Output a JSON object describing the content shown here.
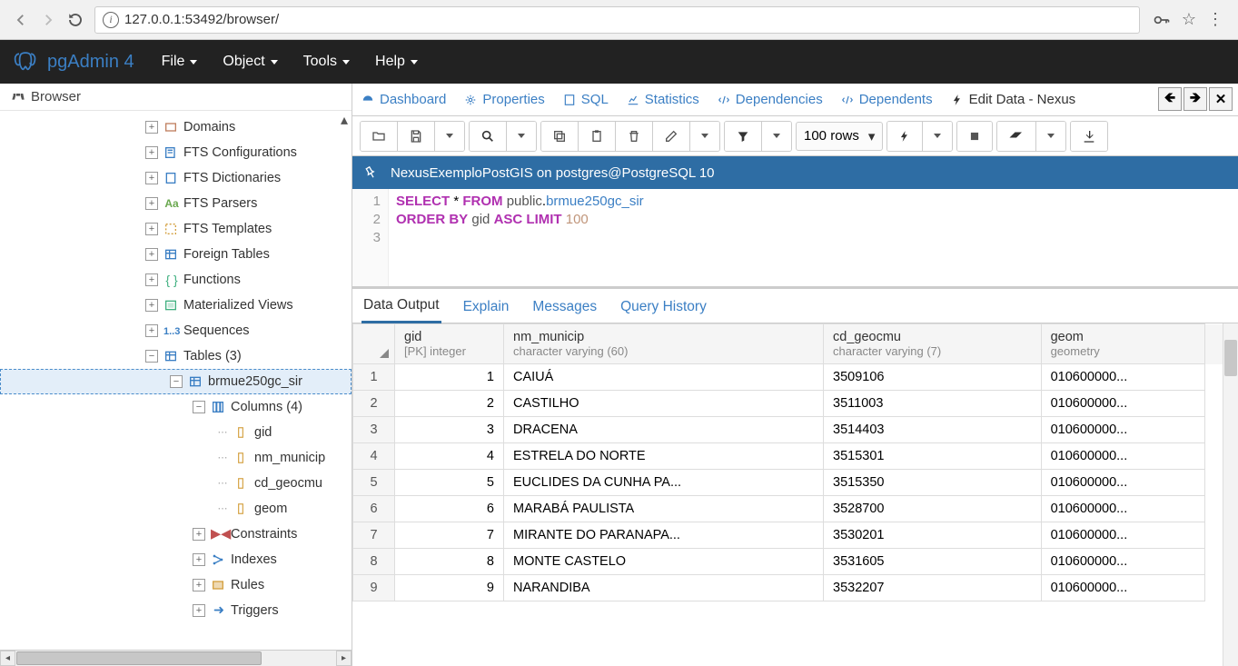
{
  "chrome": {
    "url": "127.0.0.1:53492/browser/"
  },
  "app": {
    "brand": "pgAdmin 4",
    "menu": [
      "File",
      "Object",
      "Tools",
      "Help"
    ]
  },
  "browser_panel": {
    "title": "Browser"
  },
  "tree": [
    {
      "depth": 0,
      "toggle": "+",
      "icon": "domain",
      "label": "Domains",
      "color": "#c08060"
    },
    {
      "depth": 0,
      "toggle": "+",
      "icon": "fts-conf",
      "label": "FTS Configurations",
      "color": "#3b7fc4"
    },
    {
      "depth": 0,
      "toggle": "+",
      "icon": "fts-dict",
      "label": "FTS Dictionaries",
      "color": "#3b7fc4"
    },
    {
      "depth": 0,
      "toggle": "+",
      "icon": "aa",
      "label": "FTS Parsers",
      "color": "#6aa84f"
    },
    {
      "depth": 0,
      "toggle": "+",
      "icon": "fts-tmpl",
      "label": "FTS Templates",
      "color": "#d4a040"
    },
    {
      "depth": 0,
      "toggle": "+",
      "icon": "table",
      "label": "Foreign Tables",
      "color": "#3b7fc4"
    },
    {
      "depth": 0,
      "toggle": "+",
      "icon": "func",
      "label": "Functions",
      "color": "#40b080"
    },
    {
      "depth": 0,
      "toggle": "+",
      "icon": "mview",
      "label": "Materialized Views",
      "color": "#40b080"
    },
    {
      "depth": 0,
      "toggle": "+",
      "icon": "seq",
      "label": "Sequences",
      "color": "#3b7fc4"
    },
    {
      "depth": 0,
      "toggle": "-",
      "icon": "table",
      "label": "Tables (3)",
      "color": "#3b7fc4"
    },
    {
      "depth": 1,
      "toggle": "-",
      "icon": "table",
      "label": "brmue250gc_sir",
      "color": "#3b7fc4",
      "selected": true
    },
    {
      "depth": 2,
      "toggle": "-",
      "icon": "columns",
      "label": "Columns (4)",
      "color": "#3b7fc4"
    },
    {
      "depth": 3,
      "toggle": "",
      "icon": "column",
      "label": "gid",
      "color": "#d4a040"
    },
    {
      "depth": 3,
      "toggle": "",
      "icon": "column",
      "label": "nm_municip",
      "color": "#d4a040"
    },
    {
      "depth": 3,
      "toggle": "",
      "icon": "column",
      "label": "cd_geocmu",
      "color": "#d4a040"
    },
    {
      "depth": 3,
      "toggle": "",
      "icon": "column",
      "label": "geom",
      "color": "#d4a040"
    },
    {
      "depth": 2,
      "toggle": "+",
      "icon": "constraint",
      "label": "Constraints",
      "color": "#c05050"
    },
    {
      "depth": 2,
      "toggle": "+",
      "icon": "index",
      "label": "Indexes",
      "color": "#3b7fc4"
    },
    {
      "depth": 2,
      "toggle": "+",
      "icon": "rule",
      "label": "Rules",
      "color": "#d4a040"
    },
    {
      "depth": 2,
      "toggle": "+",
      "icon": "trigger",
      "label": "Triggers",
      "color": "#3b7fc4"
    }
  ],
  "tabs": [
    {
      "icon": "dashboard",
      "label": "Dashboard"
    },
    {
      "icon": "cog",
      "label": "Properties"
    },
    {
      "icon": "sql",
      "label": "SQL"
    },
    {
      "icon": "chart",
      "label": "Statistics"
    },
    {
      "icon": "link",
      "label": "Dependencies"
    },
    {
      "icon": "link",
      "label": "Dependents"
    }
  ],
  "active_tab": {
    "icon": "bolt",
    "label": "Edit Data - Nexus"
  },
  "toolbar": {
    "rows_label": "100 rows"
  },
  "query_header": "NexusExemploPostGIS on postgres@PostgreSQL 10",
  "sql": {
    "line1": {
      "kw1": "SELECT",
      "star": "*",
      "kw2": "FROM",
      "schema": "public",
      "dot": ".",
      "table": "brmue250gc_sir"
    },
    "line2": {
      "kw1": "ORDER BY",
      "col": "gid",
      "kw2": "ASC LIMIT",
      "num": "100"
    }
  },
  "result_tabs": [
    "Data Output",
    "Explain",
    "Messages",
    "Query History"
  ],
  "columns": [
    {
      "name": "gid",
      "type": "[PK] integer"
    },
    {
      "name": "nm_municip",
      "type": "character varying (60)"
    },
    {
      "name": "cd_geocmu",
      "type": "character varying (7)"
    },
    {
      "name": "geom",
      "type": "geometry"
    }
  ],
  "rows": [
    {
      "n": 1,
      "gid": 1,
      "nm": "CAIUÁ",
      "cd": "3509106",
      "geom": "010600000..."
    },
    {
      "n": 2,
      "gid": 2,
      "nm": "CASTILHO",
      "cd": "3511003",
      "geom": "010600000..."
    },
    {
      "n": 3,
      "gid": 3,
      "nm": "DRACENA",
      "cd": "3514403",
      "geom": "010600000..."
    },
    {
      "n": 4,
      "gid": 4,
      "nm": "ESTRELA DO NORTE",
      "cd": "3515301",
      "geom": "010600000..."
    },
    {
      "n": 5,
      "gid": 5,
      "nm": "EUCLIDES DA CUNHA PA...",
      "cd": "3515350",
      "geom": "010600000..."
    },
    {
      "n": 6,
      "gid": 6,
      "nm": "MARABÁ PAULISTA",
      "cd": "3528700",
      "geom": "010600000..."
    },
    {
      "n": 7,
      "gid": 7,
      "nm": "MIRANTE DO PARANAPA...",
      "cd": "3530201",
      "geom": "010600000..."
    },
    {
      "n": 8,
      "gid": 8,
      "nm": "MONTE CASTELO",
      "cd": "3531605",
      "geom": "010600000..."
    },
    {
      "n": 9,
      "gid": 9,
      "nm": "NARANDIBA",
      "cd": "3532207",
      "geom": "010600000..."
    }
  ]
}
